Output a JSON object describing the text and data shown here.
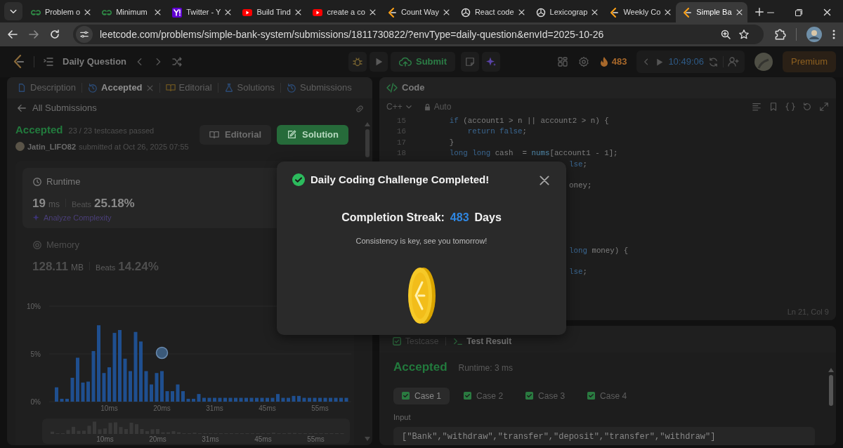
{
  "browser": {
    "tabs": [
      {
        "title": "Problem o",
        "kind": "gfg",
        "selected": false
      },
      {
        "title": "Minimum",
        "kind": "gfg",
        "selected": false
      },
      {
        "title": "Twitter - Y",
        "kind": "yahoo",
        "selected": false
      },
      {
        "title": "Build Tind",
        "kind": "youtube",
        "selected": false
      },
      {
        "title": "create a co",
        "kind": "youtube",
        "selected": false
      },
      {
        "title": "Count Way",
        "kind": "lc",
        "selected": false
      },
      {
        "title": "React code",
        "kind": "gpt",
        "selected": false
      },
      {
        "title": "Lexicograp",
        "kind": "gpt",
        "selected": false
      },
      {
        "title": "Weekly Co",
        "kind": "lc",
        "selected": false
      },
      {
        "title": "Simple Ba",
        "kind": "lc",
        "selected": true
      }
    ],
    "url": "leetcode.com/problems/simple-bank-system/submissions/1811730822/?envType=daily-question&envId=2025-10-26"
  },
  "header": {
    "title": "Daily Question",
    "submit": "Submit",
    "streak": "483",
    "timer": "10:49:06",
    "premium": "Premium"
  },
  "left_panel": {
    "tabs": [
      {
        "label": "Description",
        "kind": "doc",
        "selected": false,
        "closable": false
      },
      {
        "label": "Accepted",
        "kind": "history",
        "selected": true,
        "closable": true
      },
      {
        "label": "Editorial",
        "kind": "book",
        "selected": false,
        "closable": false
      },
      {
        "label": "Solutions",
        "kind": "flask",
        "selected": false,
        "closable": false
      },
      {
        "label": "Submissions",
        "kind": "history",
        "selected": false,
        "closable": false
      }
    ],
    "back": "All Submissions",
    "status": "Accepted",
    "testcases": "23 / 23 testcases passed",
    "user": "Jatin_LIFO82",
    "submitted": "submitted at Oct 26, 2025 07:55",
    "buttons": [
      {
        "label": "Editorial",
        "kind": "secondary"
      },
      {
        "label": "Solution",
        "kind": "primary"
      }
    ],
    "runtime": {
      "title": "Runtime",
      "value": "19",
      "unit": "ms",
      "beats_label": "Beats",
      "beats": "25.18%",
      "action": "Analyze Complexity"
    },
    "memory": {
      "title": "Memory",
      "value": "128.11",
      "unit": "MB",
      "beats_label": "Beats",
      "beats": "14.24%"
    },
    "chart_data": {
      "type": "bar",
      "ylim": [
        0,
        10
      ],
      "yticks": [
        {
          "value": 0,
          "label": "0%"
        },
        {
          "value": 5,
          "label": "5%"
        },
        {
          "value": 10,
          "label": "10%"
        }
      ],
      "categories": [
        null,
        null,
        null,
        null,
        null,
        null,
        null,
        null,
        null,
        null,
        "10ms",
        null,
        null,
        null,
        null,
        null,
        null,
        null,
        null,
        null,
        "20ms",
        null,
        null,
        null,
        null,
        null,
        null,
        null,
        null,
        null,
        "31ms",
        null,
        null,
        null,
        null,
        null,
        null,
        null,
        null,
        null,
        "45ms",
        null,
        null,
        null,
        null,
        null,
        null,
        null,
        null,
        null,
        "55ms",
        null,
        null,
        null,
        null,
        null
      ],
      "values": [
        1.5,
        0.3,
        0.3,
        2.5,
        4.6,
        2.0,
        2.1,
        5.3,
        8.0,
        3.0,
        3.6,
        7.2,
        7.5,
        4.5,
        3.2,
        7.3,
        6.3,
        3.2,
        1.8,
        3.0,
        3.2,
        1.1,
        1.1,
        1.8,
        1.1,
        0.3,
        0.3,
        0.8,
        0.4,
        0.4,
        0.4,
        0.4,
        0.4,
        0.4,
        0.4,
        0.4,
        0.4,
        0.4,
        0.4,
        0.4,
        0.4,
        0.4,
        0.8,
        0.4,
        0.4,
        0.6,
        0.6,
        0.4,
        0.4,
        0.4,
        0.4,
        0.4,
        0.4,
        0.4,
        0.4,
        0.4
      ]
    },
    "overview": {
      "labels": [
        "10ms",
        "20ms",
        "31ms",
        "45ms",
        "55ms"
      ]
    }
  },
  "code": {
    "title": "Code",
    "language": "C++",
    "mode": "Auto",
    "lines": [
      {
        "number": "15",
        "tokens": [
          {
            "text": "        if",
            "kind": "kw"
          },
          {
            "text": " (account1 > n || account2 > n) {",
            "kind": "plain"
          }
        ]
      },
      {
        "number": "16",
        "tokens": [
          {
            "text": "            return false",
            "kind": "kw"
          },
          {
            "text": ";",
            "kind": "plain"
          }
        ]
      },
      {
        "number": "17",
        "tokens": [
          {
            "text": "        }",
            "kind": "plain"
          }
        ]
      },
      {
        "number": "18",
        "tokens": [
          {
            "text": "        long long",
            "kind": "kw"
          },
          {
            "text": " cash  = ",
            "kind": "plain"
          },
          {
            "text": "nums",
            "kind": "fn"
          },
          {
            "text": "[account1 - 1];",
            "kind": "plain"
          }
        ]
      }
    ],
    "fragments": [
      {
        "tokens": [
          {
            "text": "lse",
            "kind": "kw"
          },
          {
            "text": ";",
            "kind": "plain"
          }
        ]
      },
      {
        "tokens": [
          {
            "text": "oney;",
            "kind": "plain"
          }
        ]
      },
      {
        "tokens": [
          {
            "text": "long",
            "kind": "kw"
          },
          {
            "text": " money) {",
            "kind": "plain"
          }
        ]
      },
      {
        "tokens": [
          {
            "text": "lse",
            "kind": "kw"
          },
          {
            "text": ";",
            "kind": "plain"
          }
        ]
      }
    ],
    "status": "Ln 21, Col 9"
  },
  "test_panel": {
    "tabs": [
      {
        "label": "Testcase",
        "kind": "checkbox",
        "selected": false
      },
      {
        "label": "Test Result",
        "kind": "terminal",
        "selected": true
      }
    ],
    "status": "Accepted",
    "runtime": "Runtime: 3 ms",
    "cases": [
      {
        "label": "Case 1",
        "selected": true,
        "passed": true
      },
      {
        "label": "Case 2",
        "selected": false,
        "passed": true
      },
      {
        "label": "Case 3",
        "selected": false,
        "passed": true
      },
      {
        "label": "Case 4",
        "selected": false,
        "passed": true
      }
    ],
    "input_label": "Input",
    "input_value": "[\"Bank\",\"withdraw\",\"transfer\",\"deposit\",\"transfer\",\"withdraw\"]"
  },
  "modal": {
    "title": "Daily Coding Challenge Completed!",
    "streak_label": "Completion Streak:",
    "streak": "483",
    "streak_unit": "Days",
    "message": "Consistency is key, see you tomorrow!"
  }
}
